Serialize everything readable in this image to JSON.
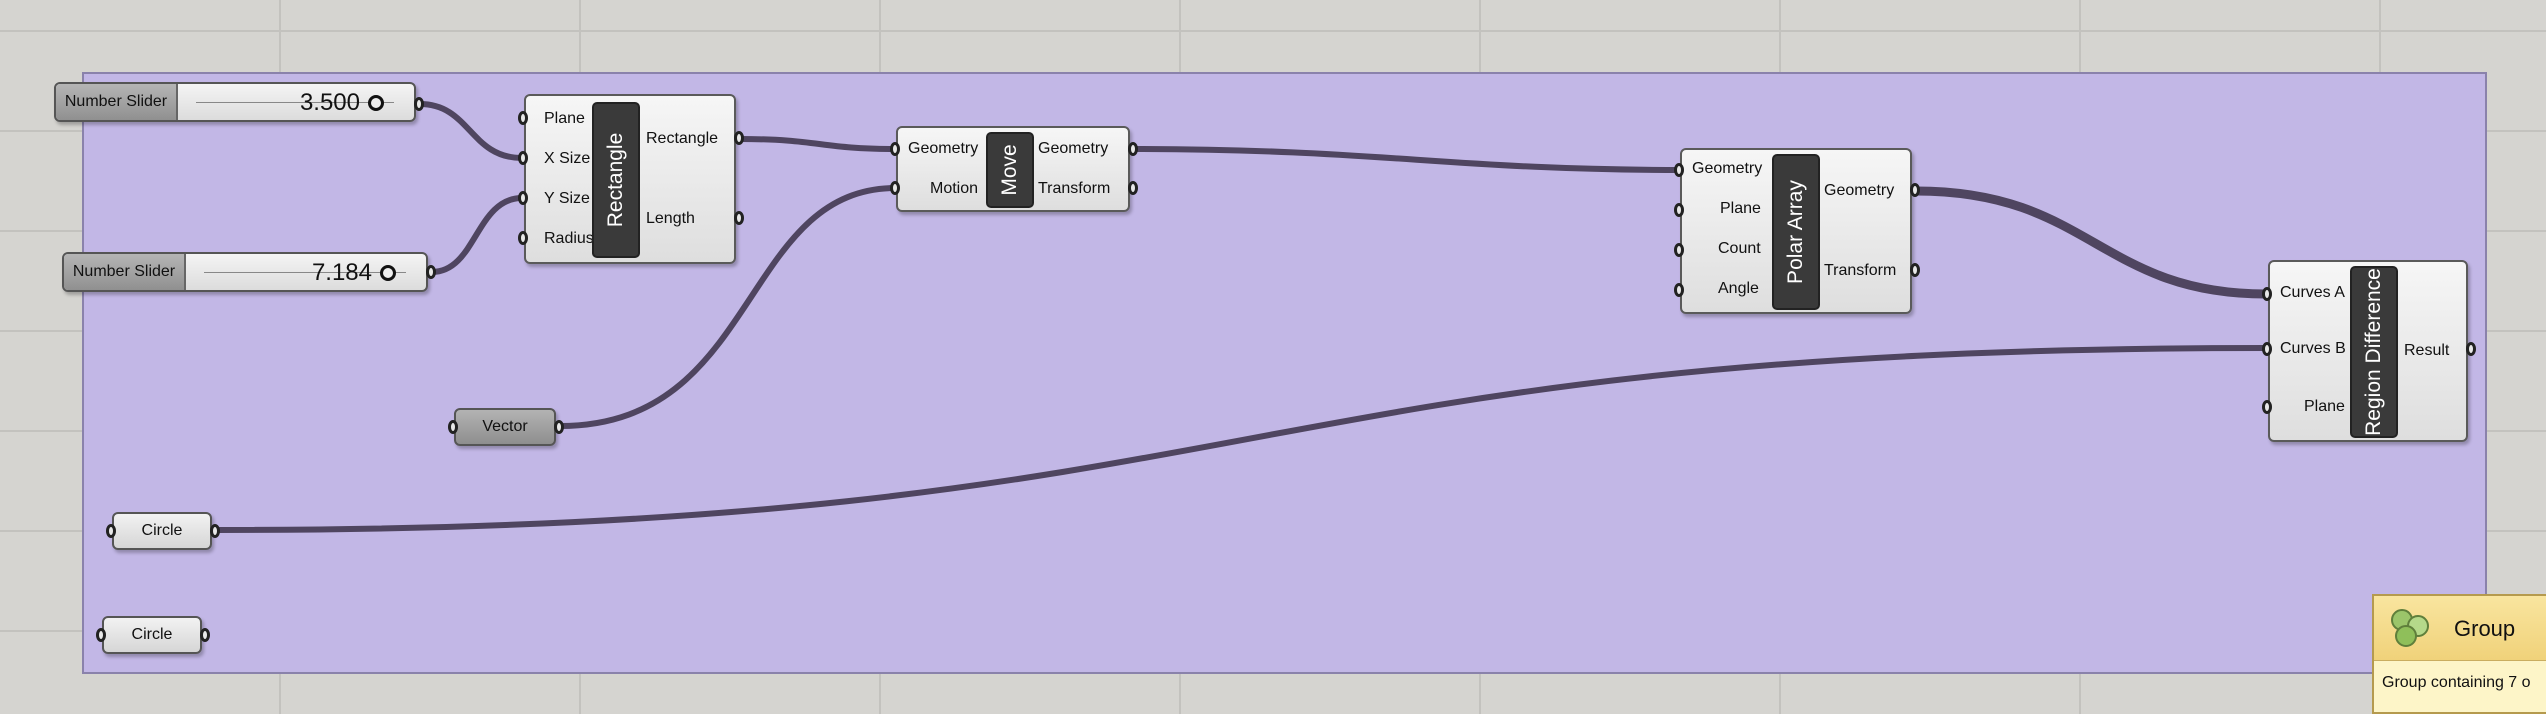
{
  "sliders": [
    {
      "label": "Number Slider",
      "value": "3.500"
    },
    {
      "label": "Number Slider",
      "value": "7.184"
    }
  ],
  "rectangle": {
    "title": "Rectangle",
    "inputs": [
      "Plane",
      "X Size",
      "Y Size",
      "Radius"
    ],
    "outputs": [
      "Rectangle",
      "Length"
    ]
  },
  "move": {
    "title": "Move",
    "inputs": [
      "Geometry",
      "Motion"
    ],
    "outputs": [
      "Geometry",
      "Transform"
    ]
  },
  "polar_array": {
    "title": "Polar Array",
    "inputs": [
      "Geometry",
      "Plane",
      "Count",
      "Angle"
    ],
    "outputs": [
      "Geometry",
      "Transform"
    ]
  },
  "region_difference": {
    "title": "Region Difference",
    "inputs": [
      "Curves A",
      "Curves B",
      "Plane"
    ],
    "outputs": [
      "Result"
    ]
  },
  "params": {
    "vector": "Vector",
    "circle_1": "Circle",
    "circle_2": "Circle"
  },
  "tooltip": {
    "title": "Group",
    "description": "Group containing 7 o",
    "icon": "group-icon"
  },
  "colors": {
    "group_fill": "#c2b7e6",
    "wire": "#4f4560",
    "component_title": "#3a3a3a"
  }
}
